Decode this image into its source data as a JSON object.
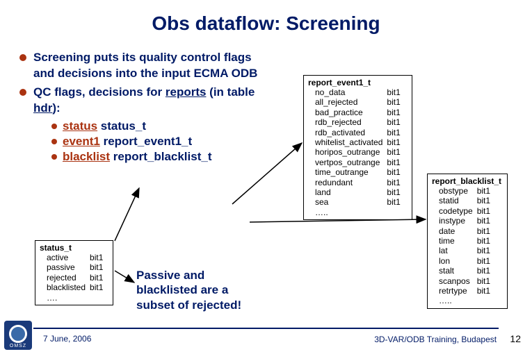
{
  "title": "Obs dataflow: Screening",
  "bullets": {
    "b1": "Screening puts its quality control flags and decisions into the input ECMA ODB",
    "b2a": "QC flags, decisions for ",
    "b2b": "reports",
    "b2c": " (in table ",
    "b2d": "hdr",
    "b2e": "):",
    "s1k": "status",
    "s1v": " status_t",
    "s2k": "event1",
    "s2v": " report_event1_t",
    "s3k": "blacklist",
    "s3v": " report_blacklist_t"
  },
  "status_box": {
    "title": "status_t",
    "rows": [
      [
        "active",
        "bit1"
      ],
      [
        "passive",
        "bit1"
      ],
      [
        "rejected",
        "bit1"
      ],
      [
        "blacklisted",
        "bit1"
      ],
      [
        "….",
        ""
      ]
    ]
  },
  "note": "Passive and blacklisted are a subset of rejected!",
  "event_box": {
    "title": "report_event1_t",
    "rows": [
      [
        "no_data",
        "bit1"
      ],
      [
        "all_rejected",
        "bit1"
      ],
      [
        "bad_practice",
        "bit1"
      ],
      [
        "rdb_rejected",
        "bit1"
      ],
      [
        "rdb_activated",
        "bit1"
      ],
      [
        "whitelist_activated",
        "bit1"
      ],
      [
        "horipos_outrange",
        "bit1"
      ],
      [
        "vertpos_outrange",
        "bit1"
      ],
      [
        "time_outrange",
        "bit1"
      ],
      [
        "redundant",
        "bit1"
      ],
      [
        "land",
        "bit1"
      ],
      [
        "sea",
        "bit1"
      ],
      [
        "…..",
        ""
      ]
    ]
  },
  "blacklist_box": {
    "title": "report_blacklist_t",
    "rows": [
      [
        "obstype",
        "bit1"
      ],
      [
        "statid",
        "bit1"
      ],
      [
        "codetype",
        "bit1"
      ],
      [
        "instype",
        "bit1"
      ],
      [
        "date",
        "bit1"
      ],
      [
        "time",
        "bit1"
      ],
      [
        "lat",
        "bit1"
      ],
      [
        "lon",
        "bit1"
      ],
      [
        "stalt",
        "bit1"
      ],
      [
        "scanpos",
        "bit1"
      ],
      [
        "retrtype",
        "bit1"
      ],
      [
        "…..",
        ""
      ]
    ]
  },
  "footer": {
    "date": "7 June, 2006",
    "course": "3D-VAR/ODB Training, Budapest",
    "page": "12"
  },
  "logo": "OMSZ"
}
